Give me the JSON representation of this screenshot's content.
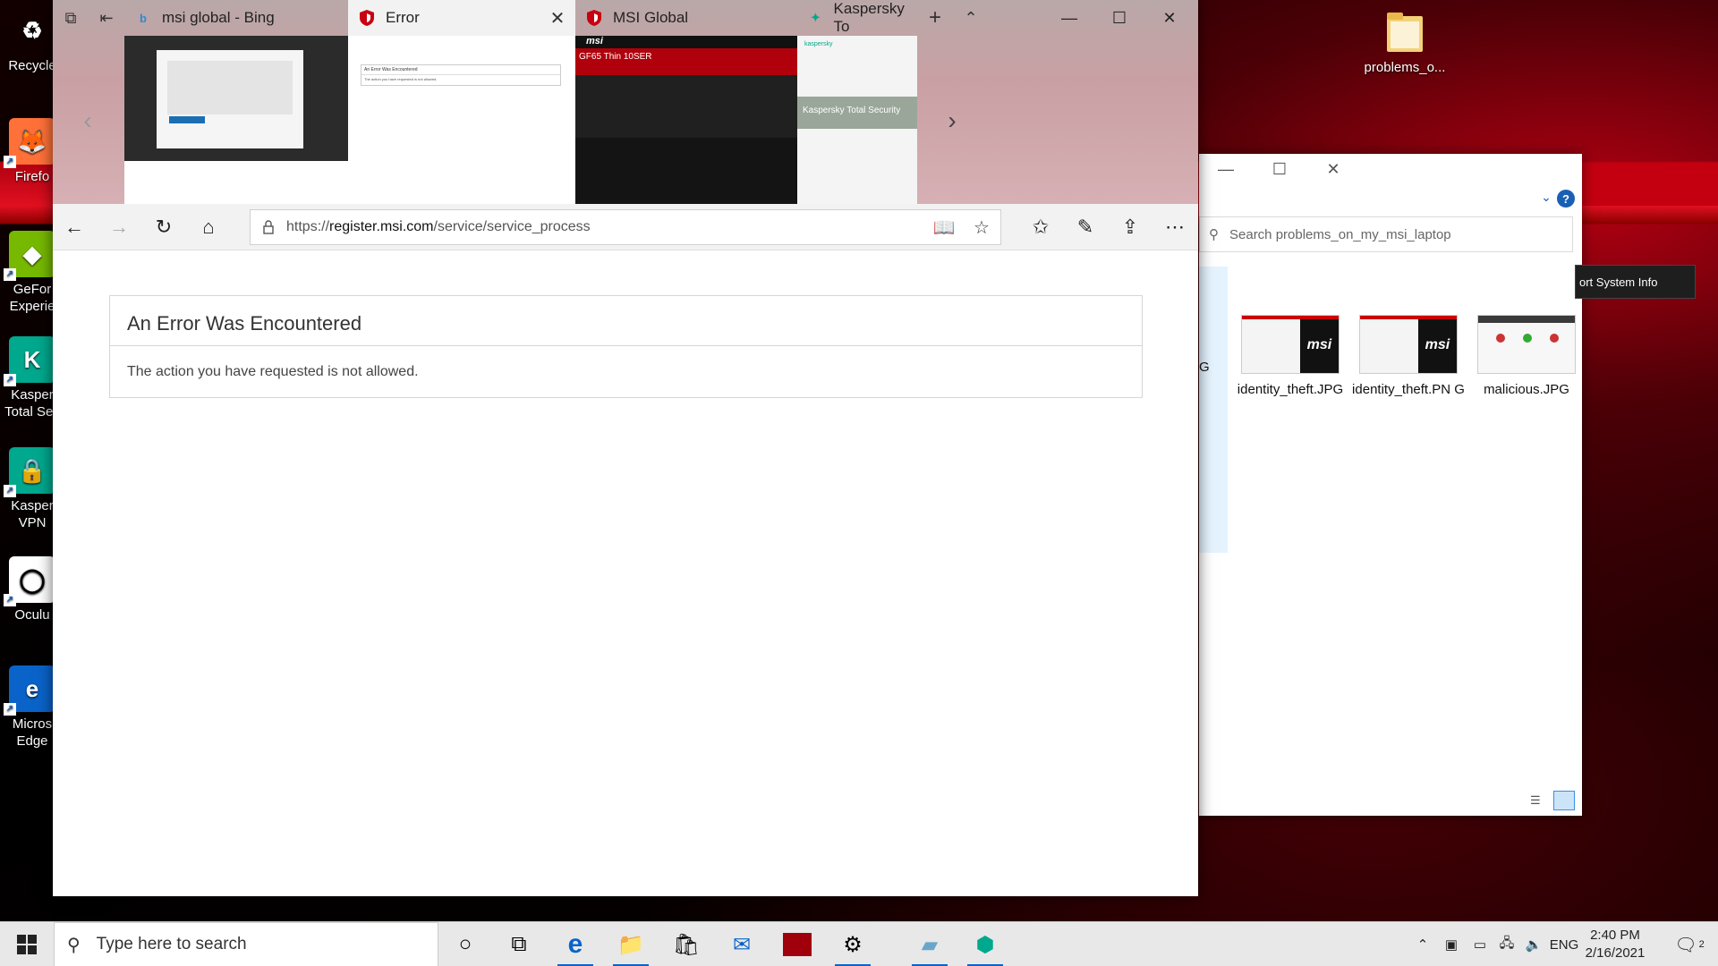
{
  "desktop": {
    "icons": [
      {
        "label": "Recycle",
        "color": "#2d6cb5",
        "glyph": "♻"
      },
      {
        "label": "Firefo",
        "color": "#ff7139",
        "glyph": "🦊"
      },
      {
        "label": "GeFor Experie",
        "color": "#76b900",
        "glyph": "◆"
      },
      {
        "label": "Kasper Total Sec",
        "color": "#00a88e",
        "glyph": "K"
      },
      {
        "label": "Kasper VPN",
        "color": "#00a88e",
        "glyph": "🔒"
      },
      {
        "label": "Oculu",
        "color": "#ffffff",
        "glyph": "◯"
      },
      {
        "label": "Micros Edge",
        "color": "#0a63c9",
        "glyph": "e"
      }
    ],
    "folder_label": "problems_o..."
  },
  "explorer": {
    "search_placeholder": "Search problems_on_my_msi_laptop",
    "partial_label": "G",
    "files": [
      {
        "name": "identity_theft.JPG"
      },
      {
        "name": "identity_theft.PN G"
      },
      {
        "name": "malicious.JPG"
      }
    ],
    "help_glyph": "?",
    "report_label": "ort System Info"
  },
  "edge": {
    "tabs": [
      {
        "title": "msi global - Bing",
        "active": false
      },
      {
        "title": "Error",
        "active": true
      },
      {
        "title": "MSI Global",
        "active": false
      },
      {
        "title": "Kaspersky To",
        "active": false
      }
    ],
    "preview_texts": {
      "error_title": "An Error Was Encountered",
      "error_msg": "The action you have requested is not allowed.",
      "msi_heading": "GF65 Thin 10SER",
      "msi_brand": "msi",
      "kaspersky_brand": "kaspersky",
      "kaspersky_hero": "Kaspersky Total Security"
    },
    "url_prefix": "https://",
    "url_host": "register.msi.com",
    "url_path": "/service/service_process",
    "page": {
      "error_title": "An Error Was Encountered",
      "error_message": "The action you have requested is not allowed."
    }
  },
  "taskbar": {
    "search_placeholder": "Type here to search",
    "language": "ENG",
    "time": "2:40 PM",
    "date": "2/16/2021",
    "notification_count": "2"
  },
  "colors": {
    "accent": "#0a63c9",
    "msi_red": "#c8000f",
    "kaspersky_green": "#00a88e"
  }
}
